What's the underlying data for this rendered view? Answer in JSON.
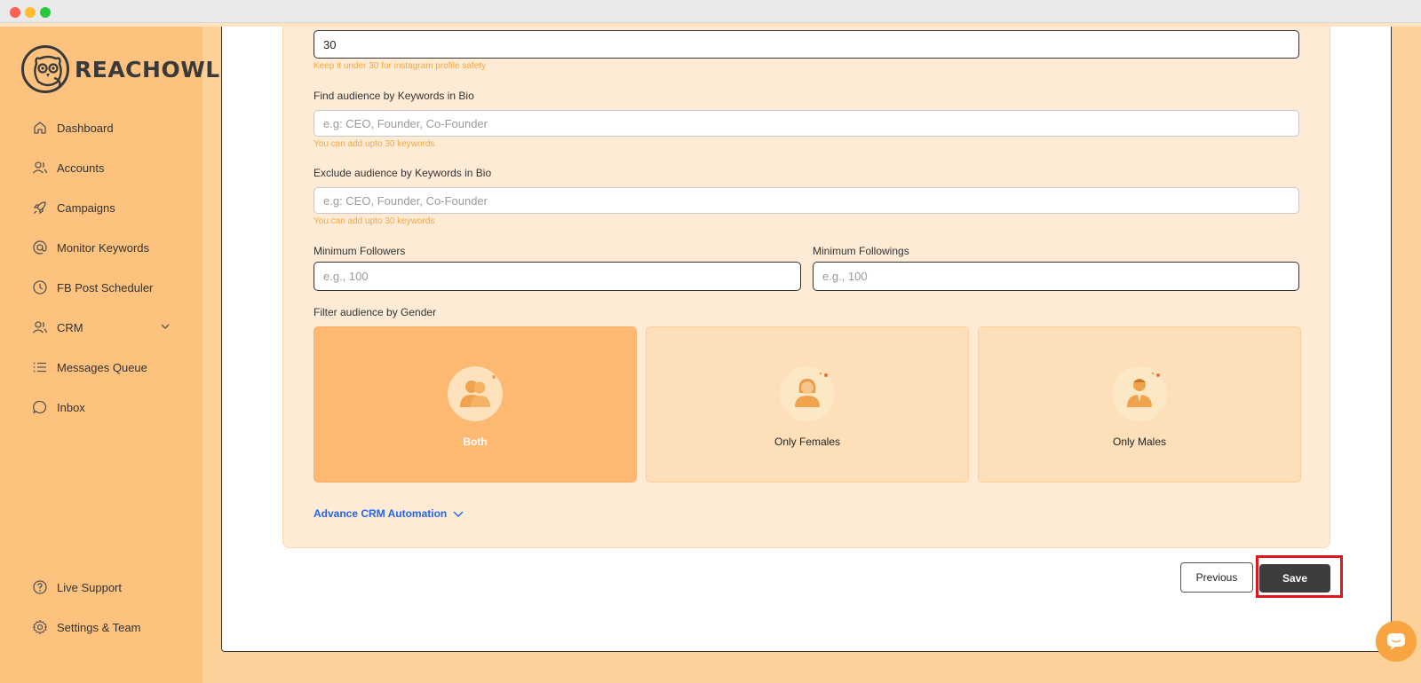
{
  "brand": {
    "name": "REACHOWL"
  },
  "sidebar": {
    "items": [
      {
        "label": "Dashboard",
        "icon": "home-icon"
      },
      {
        "label": "Accounts",
        "icon": "users-icon"
      },
      {
        "label": "Campaigns",
        "icon": "rocket-icon"
      },
      {
        "label": "Monitor Keywords",
        "icon": "at-sign-icon"
      },
      {
        "label": "FB Post Scheduler",
        "icon": "clock-icon"
      },
      {
        "label": "CRM",
        "icon": "users-icon",
        "expandable": true
      },
      {
        "label": "Messages Queue",
        "icon": "list-icon"
      },
      {
        "label": "Inbox",
        "icon": "chat-icon"
      }
    ],
    "bottom_items": [
      {
        "label": "Live Support",
        "icon": "help-circle-icon"
      },
      {
        "label": "Settings & Team",
        "icon": "gear-icon"
      }
    ]
  },
  "form": {
    "limit_value": "30",
    "limit_hint": "Keep it under 30 for instagram profile safety",
    "include_keywords": {
      "label": "Find audience by Keywords in Bio",
      "placeholder": "e.g: CEO, Founder, Co-Founder",
      "hint": "You can add upto 30 keywords"
    },
    "exclude_keywords": {
      "label": "Exclude audience by Keywords in Bio",
      "placeholder": "e.g: CEO, Founder, Co-Founder",
      "hint": "You can add upto 30 keywords"
    },
    "min_followers": {
      "label": "Minimum Followers",
      "placeholder": "e.g., 100"
    },
    "min_followings": {
      "label": "Minimum Followings",
      "placeholder": "e.g., 100"
    },
    "gender": {
      "label": "Filter audience by Gender",
      "selected": "Both",
      "options": [
        {
          "label": "Both",
          "icon": "couple-icon"
        },
        {
          "label": "Only Females",
          "icon": "female-icon"
        },
        {
          "label": "Only Males",
          "icon": "male-icon"
        }
      ]
    },
    "advance_label": "Advance CRM Automation"
  },
  "actions": {
    "previous_label": "Previous",
    "save_label": "Save"
  },
  "colors": {
    "sidebar_bg": "#fdc27d",
    "accent": "#f7a441",
    "link": "#2563eb",
    "save_bg": "#3d3d3d",
    "highlight": "#e0161e"
  }
}
